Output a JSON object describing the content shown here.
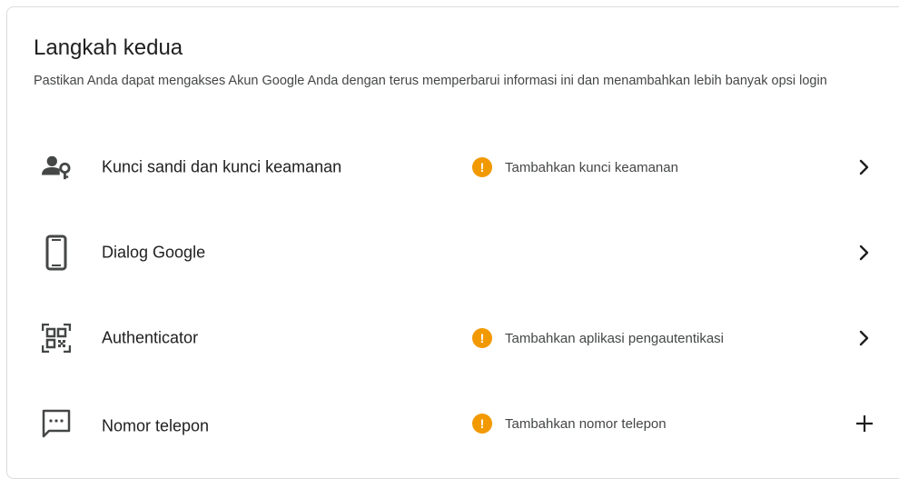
{
  "section": {
    "title": "Langkah kedua",
    "description": "Pastikan Anda dapat mengakses Akun Google Anda dengan terus memperbarui informasi ini dan menambahkan lebih banyak opsi login"
  },
  "rows": [
    {
      "label": "Kunci sandi dan kunci keamanan",
      "icon": "passkey-person-key-icon",
      "status": "Tambahkan kunci keamanan",
      "status_icon": "warning-icon",
      "action_icon": "chevron-right-icon"
    },
    {
      "label": "Dialog Google",
      "icon": "smartphone-icon",
      "status": "",
      "action_icon": "chevron-right-icon"
    },
    {
      "label": "Authenticator",
      "icon": "qr-code-scanner-icon",
      "status": "Tambahkan aplikasi pengautentikasi",
      "status_icon": "warning-icon",
      "action_icon": "chevron-right-icon"
    },
    {
      "label": "Nomor telepon",
      "icon": "sms-message-icon",
      "status": "Tambahkan nomor telepon",
      "status_icon": "warning-icon",
      "action_icon": "plus-icon"
    }
  ],
  "warning_symbol": "!",
  "colors": {
    "warning": "#f29900",
    "icon": "#444746",
    "text": "#1f1f1f",
    "secondary_text": "#444746",
    "border": "#dadce0"
  }
}
